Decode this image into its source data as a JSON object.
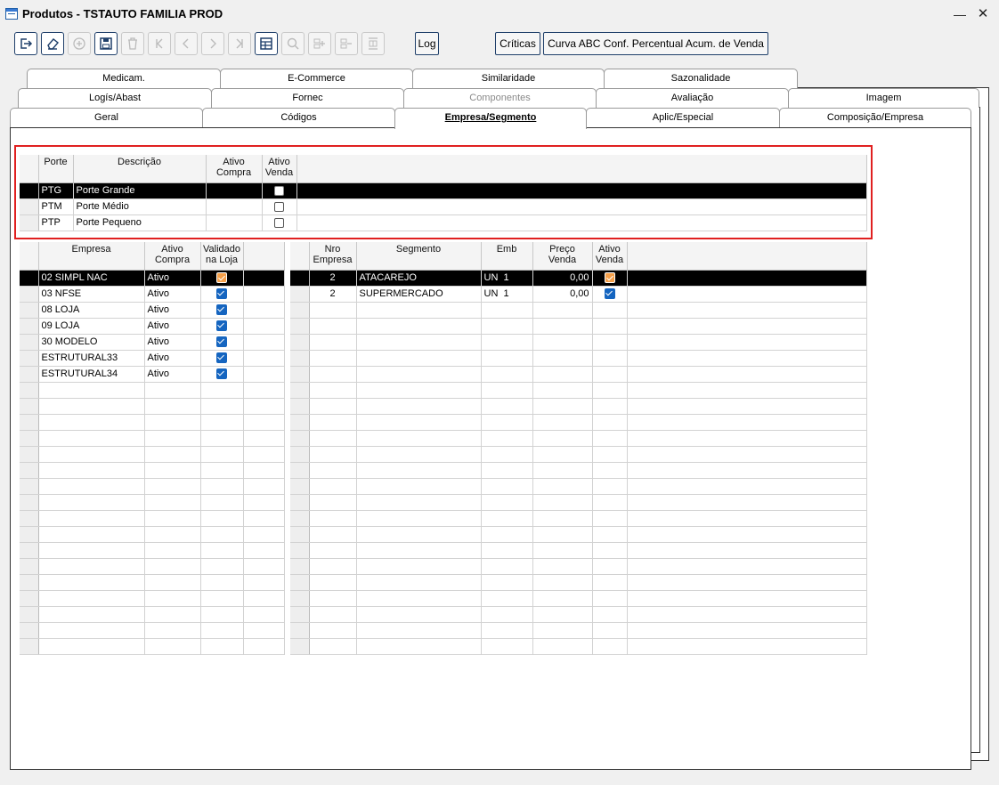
{
  "window": {
    "title": "Produtos - TSTAUTO FAMILIA PROD",
    "minimize": "—",
    "close": "✕"
  },
  "toolbar": {
    "buttons": [
      {
        "name": "exit-icon",
        "state": "active"
      },
      {
        "name": "eraser-icon",
        "state": "active"
      },
      {
        "name": "add-icon",
        "state": "disabled"
      },
      {
        "name": "save-icon",
        "state": "active"
      },
      {
        "name": "delete-icon",
        "state": "disabled"
      },
      {
        "name": "first-record-icon",
        "state": "disabled"
      },
      {
        "name": "previous-record-icon",
        "state": "disabled"
      },
      {
        "name": "next-record-icon",
        "state": "disabled"
      },
      {
        "name": "last-record-icon",
        "state": "disabled"
      },
      {
        "name": "table-view-icon",
        "state": "active"
      },
      {
        "name": "search-icon",
        "state": "disabled"
      },
      {
        "name": "insert-row-icon",
        "state": "disabled"
      },
      {
        "name": "remove-row-icon",
        "state": "disabled"
      },
      {
        "name": "row-settings-icon",
        "state": "disabled"
      }
    ],
    "log_label": "Log",
    "criticas_label": "Críticas",
    "curva_label": "Curva ABC Conf. Percentual Acum. de Venda"
  },
  "tabs": {
    "row1": [
      "Medicam.",
      "E-Commerce",
      "Similaridade",
      "Sazonalidade"
    ],
    "row2": [
      "Logís/Abast",
      "Fornec",
      "Componentes",
      "Avaliação",
      "Imagem"
    ],
    "row3": [
      "Geral",
      "Códigos",
      "Empresa/Segmento",
      "Aplic/Especial",
      "Composição/Empresa"
    ]
  },
  "porte_grid": {
    "headers": {
      "porte": "Porte",
      "descricao": "Descrição",
      "ativo_compra": "Ativo\nCompra",
      "ativo_venda": "Ativo\nVenda"
    },
    "rows": [
      {
        "porte": "PTG",
        "descricao": "Porte Grande",
        "ativo_compra": "",
        "ativo_venda": false
      },
      {
        "porte": "PTM",
        "descricao": "Porte Médio",
        "ativo_compra": "",
        "ativo_venda": false
      },
      {
        "porte": "PTP",
        "descricao": "Porte Pequeno",
        "ativo_compra": "",
        "ativo_venda": false
      }
    ],
    "selected_index": 0
  },
  "empresa_grid": {
    "headers": {
      "empresa": "Empresa",
      "ativo_compra": "Ativo\nCompra",
      "validado": "Validado\nna Loja"
    },
    "rows": [
      {
        "empresa": "02 SIMPL NAC",
        "ativo_compra": "Ativo",
        "validado": true
      },
      {
        "empresa": "03 NFSE",
        "ativo_compra": "Ativo",
        "validado": true
      },
      {
        "empresa": "08 LOJA",
        "ativo_compra": "Ativo",
        "validado": true
      },
      {
        "empresa": "09 LOJA",
        "ativo_compra": "Ativo",
        "validado": true
      },
      {
        "empresa": "30 MODELO",
        "ativo_compra": "Ativo",
        "validado": true
      },
      {
        "empresa": "ESTRUTURAL33",
        "ativo_compra": "Ativo",
        "validado": true
      },
      {
        "empresa": "ESTRUTURAL34",
        "ativo_compra": "Ativo",
        "validado": true
      }
    ],
    "selected_index": 0
  },
  "segmento_grid": {
    "headers": {
      "nro_empresa": "Nro\nEmpresa",
      "segmento": "Segmento",
      "emb": "Emb",
      "preco_venda": "Preço\nVenda",
      "ativo_venda": "Ativo\nVenda"
    },
    "rows": [
      {
        "nro_empresa": "2",
        "segmento": "ATACAREJO",
        "emb": "UN  1",
        "preco_venda": "0,00",
        "ativo_venda": true
      },
      {
        "nro_empresa": "2",
        "segmento": "SUPERMERCADO",
        "emb": "UN  1",
        "preco_venda": "0,00",
        "ativo_venda": true
      }
    ],
    "selected_index": 0
  },
  "colors": {
    "highlight": "#e02020",
    "checkbox": "#1565c0",
    "checkbox_selected": "#f5a04a",
    "selection": "#000000"
  }
}
